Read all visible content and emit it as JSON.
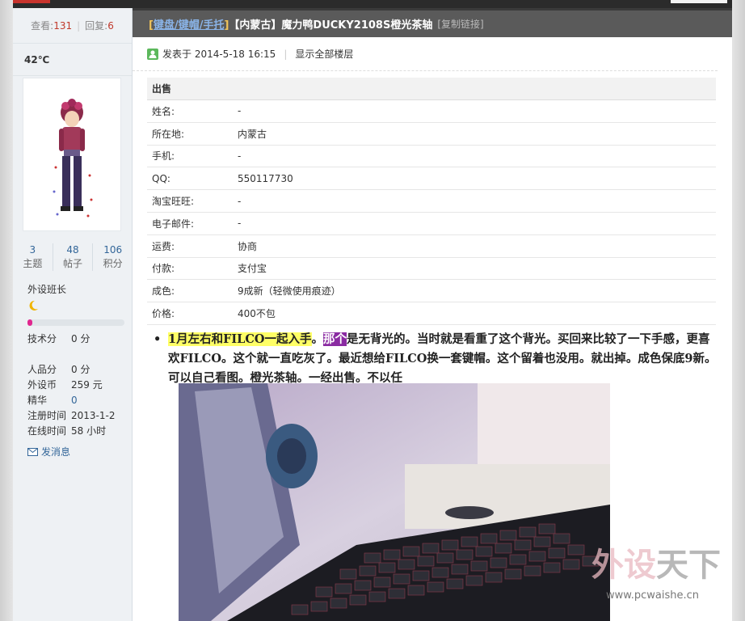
{
  "sidebar": {
    "views_label": "查看:",
    "views": "131",
    "replies_label": "回复:",
    "replies": "6",
    "temp": "42℃",
    "counts": [
      {
        "value": "3",
        "label": "主题"
      },
      {
        "value": "48",
        "label": "帖子"
      },
      {
        "value": "106",
        "label": "积分"
      }
    ],
    "rank": "外设班长",
    "rank_progress": 0.05,
    "fields": [
      {
        "k": "技术分",
        "v": "0 分"
      },
      {
        "k": "人品分",
        "v": "0 分"
      },
      {
        "k": "外设币",
        "v": "259 元"
      },
      {
        "k": "精华",
        "v": "0"
      },
      {
        "k": "注册时间",
        "v": "2013-1-2"
      },
      {
        "k": "在线时间",
        "v": "58 小时"
      }
    ],
    "send_message": "发消息"
  },
  "thread": {
    "category_open": "[",
    "category": "键盘/键帽/手托",
    "category_close": "]",
    "title": "【内蒙古】魔力鸭DUCKY2108S橙光茶轴",
    "copy_link": "[复制链接]",
    "posted": "发表于 2014-5-18 16:15",
    "show_all": "显示全部楼层"
  },
  "sale": {
    "heading": "出售",
    "rows": [
      {
        "k": "姓名:",
        "v": "-"
      },
      {
        "k": "所在地:",
        "v": "内蒙古"
      },
      {
        "k": "手机:",
        "v": "-"
      },
      {
        "k": "QQ:",
        "v": "550117730"
      },
      {
        "k": "淘宝旺旺:",
        "v": "-"
      },
      {
        "k": "电子邮件:",
        "v": "-"
      },
      {
        "k": "运费:",
        "v": "协商"
      },
      {
        "k": "付款:",
        "v": "支付宝"
      },
      {
        "k": "成色:",
        "v": "9成新（轻微使用痕迹）"
      },
      {
        "k": "价格:",
        "v": "400不包"
      }
    ]
  },
  "post": {
    "bullet": "•",
    "part1": "1月左右和FILCO一起入手",
    "part2": "。",
    "part3": "那个",
    "part4": "是无背光的。当时就是看重了这个背光。买回来比较了一下手感，更喜欢FILCO。这个就一直吃灰了。最近想给FILCO换一套键帽。这个留着也没用。就出掉。成色保底9新。可以自己看图。橙光茶轴。一经出售。不以任"
  },
  "watermark": {
    "brand": "外设天下",
    "url": "www.pcwaishe.cn"
  },
  "colors": {
    "accent_red": "#c0392b",
    "link_blue": "#336699",
    "title_bar": "#5a5a5a",
    "highlight_yellow": "#ffff66",
    "highlight_purple": "#8a2ba2"
  }
}
